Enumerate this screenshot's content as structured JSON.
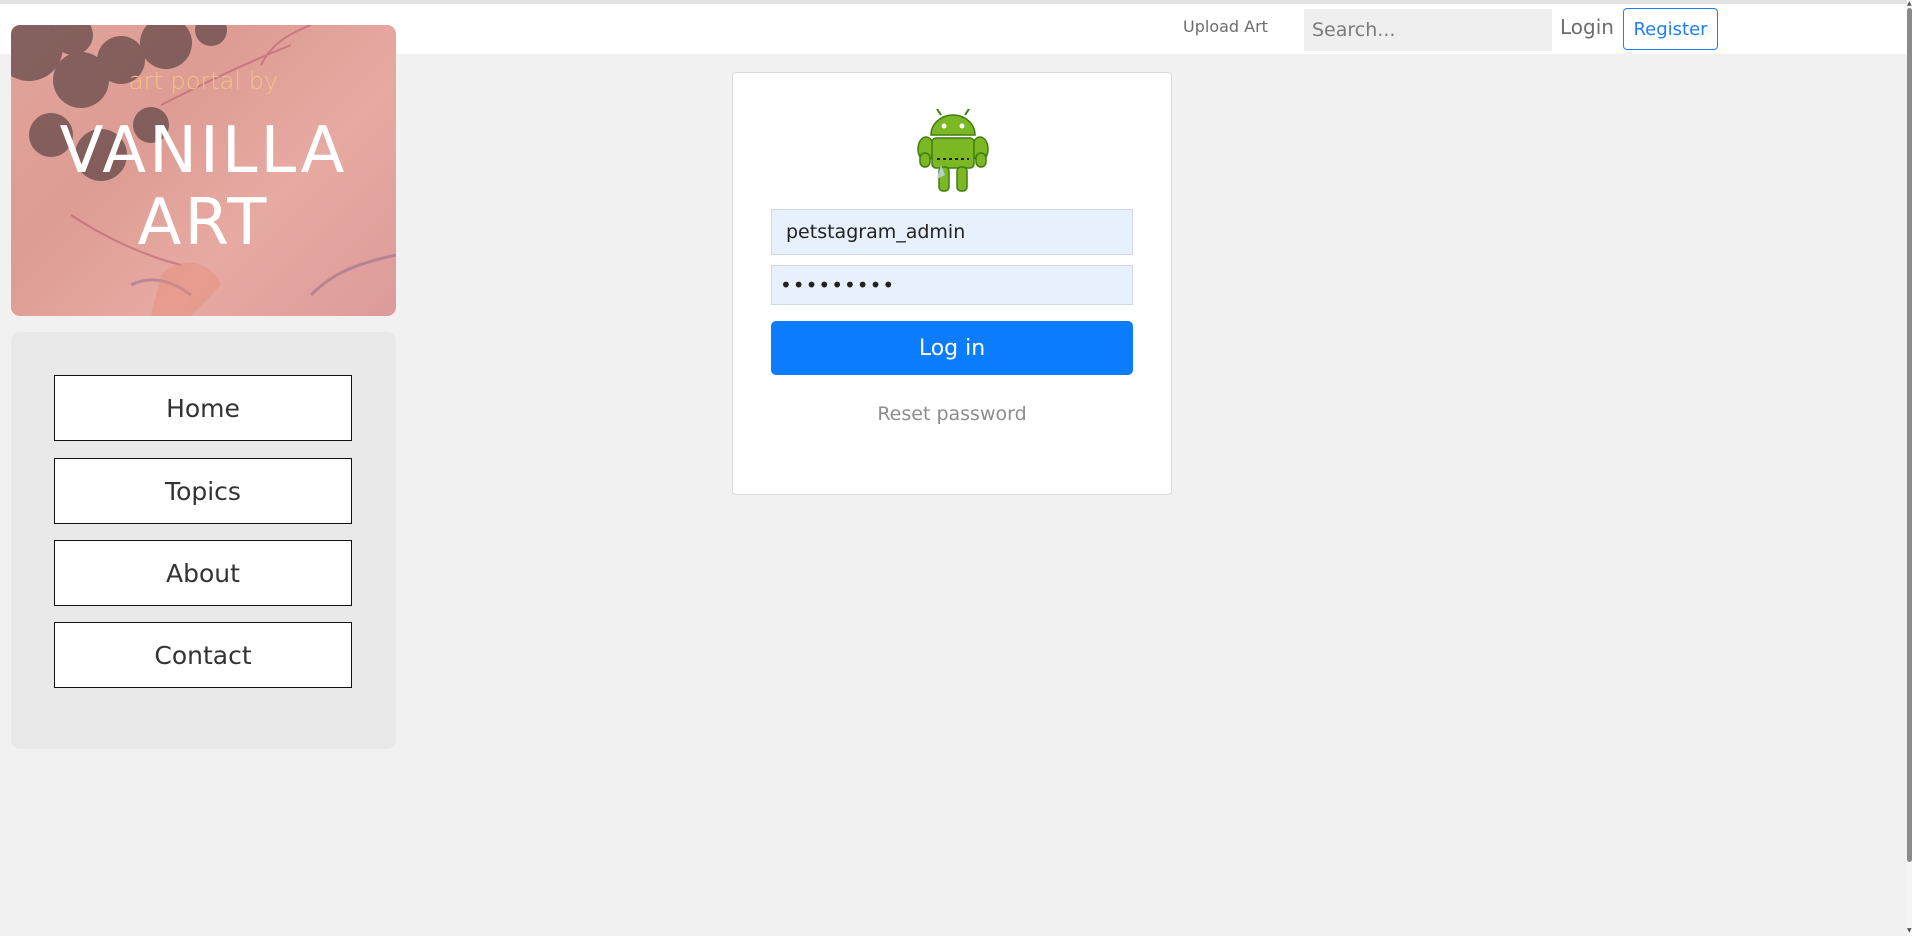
{
  "header": {
    "upload_label": "Upload Art",
    "search_placeholder": "Search...",
    "login_label": "Login",
    "register_label": "Register"
  },
  "brand": {
    "subtitle": "art portal by",
    "title_line1": "VANILLA",
    "title_line2": "ART"
  },
  "sidebar": {
    "items": [
      {
        "label": "Home"
      },
      {
        "label": "Topics"
      },
      {
        "label": "About"
      },
      {
        "label": "Contact"
      }
    ]
  },
  "login_form": {
    "avatar_icon": "android-robot-icon",
    "username_value": "petstagram_admin",
    "password_value": "•••••••••",
    "submit_label": "Log in",
    "reset_label": "Reset password"
  },
  "colors": {
    "accent": "#0a7cfd",
    "register_border": "#1e7ef7",
    "brand_subtitle": "#f2c386",
    "input_fill": "#e8f0fd"
  }
}
